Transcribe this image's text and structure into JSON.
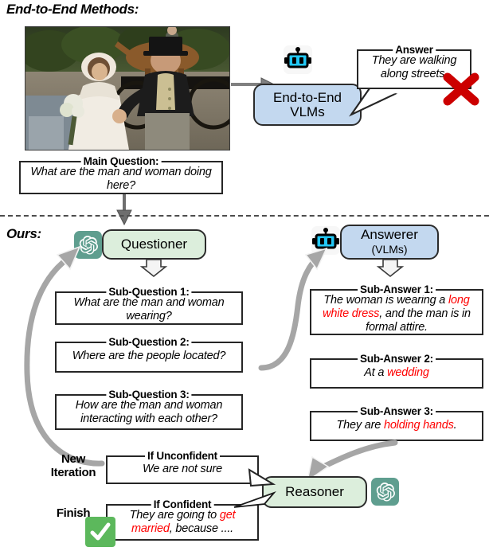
{
  "sections": {
    "top_title": "End-to-End Methods:",
    "bottom_title": "Ours:"
  },
  "colors": {
    "accent_green": "#dceedc",
    "accent_blue": "#c3d8ef",
    "openai_chip": "#5f9e8f",
    "highlight_red": "#ff0000",
    "error_x": "#cc0000",
    "check_green": "#5cb85c",
    "arrow_gray": "#9d9d9d"
  },
  "top": {
    "photo_alt": "wedding-couple-photo",
    "e2e_model": {
      "line1": "End-to-End",
      "line2": "VLMs"
    },
    "answer_box": {
      "legend": "Answer",
      "text": "They are walking along streets."
    },
    "main_question": {
      "legend": "Main Question:",
      "text": "What are the man and woman doing here?"
    },
    "verdict_icon": "cross-mark-icon"
  },
  "ours": {
    "questioner": {
      "label": "Questioner",
      "icon": "openai-logo-icon"
    },
    "answerer": {
      "label": "Answerer",
      "sublabel": "(VLMs)",
      "icon": "robot-icon"
    },
    "reasoner": {
      "label": "Reasoner",
      "icon": "openai-logo-icon"
    },
    "sub_questions": [
      {
        "legend": "Sub-Question 1:",
        "text": "What are the man and woman wearing?"
      },
      {
        "legend": "Sub-Question 2:",
        "text": "Where are the people located?"
      },
      {
        "legend": "Sub-Question 3:",
        "text": "How are the man and woman interacting with each other?"
      }
    ],
    "sub_answers": [
      {
        "legend": "Sub-Answer 1:",
        "parts": [
          {
            "t": "The woman is wearing a ",
            "hl": false
          },
          {
            "t": "long white dress",
            "hl": true
          },
          {
            "t": ", and the man is in formal attire.",
            "hl": false
          }
        ]
      },
      {
        "legend": "Sub-Answer 2:",
        "parts": [
          {
            "t": "At a ",
            "hl": false
          },
          {
            "t": "wedding",
            "hl": true
          }
        ]
      },
      {
        "legend": "Sub-Answer 3:",
        "parts": [
          {
            "t": "They are ",
            "hl": false
          },
          {
            "t": "holding hands",
            "hl": true
          },
          {
            "t": ".",
            "hl": false
          }
        ]
      }
    ],
    "outcomes": {
      "new_iteration_label": "New\nIteration",
      "finish_label": "Finish",
      "unconfident": {
        "legend": "If Unconfident",
        "text": "We are not sure"
      },
      "confident": {
        "legend": "If Confident",
        "parts": [
          {
            "t": "They are going to ",
            "hl": false
          },
          {
            "t": "get married",
            "hl": true
          },
          {
            "t": ", because ....",
            "hl": false
          }
        ]
      },
      "finish_icon": "check-mark-icon"
    }
  }
}
